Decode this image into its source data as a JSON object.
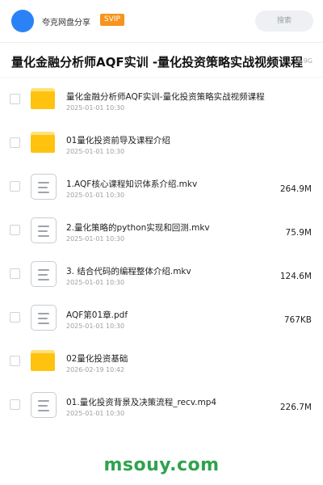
{
  "header": {
    "username": "夸克网盘分享",
    "badge": "SVIP",
    "search_placeholder": "搜索"
  },
  "title_bar": {
    "title": "量化金融分析师AQF实训 -量化投资策略实战视频课程",
    "total_size": "8.9G"
  },
  "files": [
    {
      "type": "folder",
      "name": "量化金融分析师AQF实训-量化投资策略实战视频课程",
      "date": "2025-01-01 10:30",
      "size": ""
    },
    {
      "type": "folder",
      "name": "01量化投资前导及课程介绍",
      "date": "2025-01-01 10:30",
      "size": ""
    },
    {
      "type": "file",
      "name": "1.AQF核心课程知识体系介绍.mkv",
      "date": "2025-01-01 10:30",
      "size": "264.9M"
    },
    {
      "type": "file",
      "name": "2.量化策略的python实现和回测.mkv",
      "date": "2025-01-01 10:30",
      "size": "75.9M"
    },
    {
      "type": "file",
      "name": "3. 结合代码的编程整体介绍.mkv",
      "date": "2025-01-01 10:30",
      "size": "124.6M"
    },
    {
      "type": "file",
      "name": "AQF第01章.pdf",
      "date": "2025-01-01 10:30",
      "size": "767KB"
    },
    {
      "type": "folder",
      "name": "02量化投资基础",
      "date": "2026-02-19 10:42",
      "size": ""
    },
    {
      "type": "file",
      "name": "01.量化投资背景及决策流程_recv.mp4",
      "date": "2025-01-01 10:30",
      "size": "226.7M"
    }
  ],
  "footer": {
    "brand": "msouy.com"
  },
  "colors": {
    "accent_blue": "#2a82f6",
    "svip_orange": "#f7941d",
    "folder_yellow": "#ffc20e",
    "brand_green": "#2fa24d"
  },
  "icons": {
    "folder": "folder-icon",
    "file": "document-icon"
  }
}
